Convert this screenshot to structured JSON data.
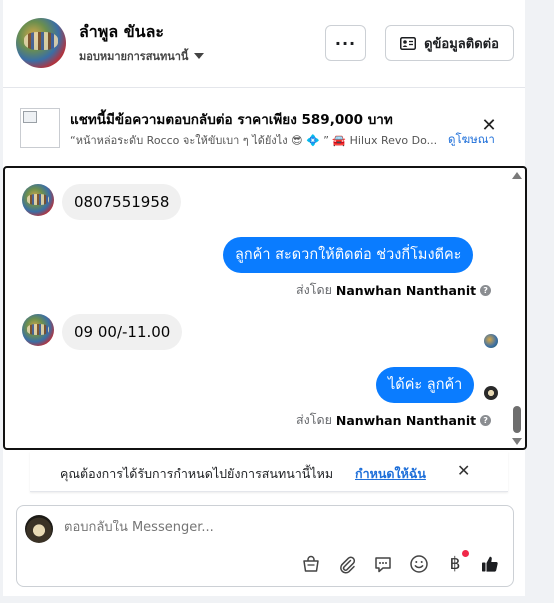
{
  "header": {
    "name": "ลำพูล ขันละ",
    "assign_label": "มอบหมายการสนทนานี้",
    "more_label": "···",
    "contact_label": "ดูข้อมูลติดต่อ"
  },
  "ad": {
    "title": "แชทนี้มีข้อความตอบกลับต่อ ราคาเพียง 589,000 บาท",
    "subtitle": "“หน้าหล่อระดับ Rocco จะให้ขับเบา ๆ ได้ยังไง 😎 💠 ” 🚘 Hilux Revo Do...",
    "link": "ดูโฆษณา",
    "close": "✕"
  },
  "messages": [
    {
      "direction": "in",
      "text": "0807551958"
    },
    {
      "direction": "out",
      "text": "ลูกค้า สะดวกให้ติดต่อ ช่วงกี่โมงดีคะ",
      "sent_prefix": "ส่งโดย",
      "sent_by": "Nanwhan Nanthanit"
    },
    {
      "direction": "in",
      "text": "09  00/-11.00"
    },
    {
      "direction": "out",
      "text": "ได้ค่ะ  ลูกค้า",
      "sent_prefix": "ส่งโดย",
      "sent_by": "Nanwhan Nanthanit"
    }
  ],
  "notice": {
    "text": "คุณต้องการได้รับการกำหนดไปยังการสนทนานี้ไหม",
    "link": "กำหนดให้ฉัน",
    "close": "✕"
  },
  "composer": {
    "placeholder": "ตอบกลับใน Messenger...",
    "baht_symbol": "฿"
  },
  "icons": {
    "toolbar": [
      "shopping-bag-icon",
      "paperclip-icon",
      "chat-bubble-icon",
      "smiley-icon",
      "baht-icon",
      "thumbs-up-icon"
    ]
  },
  "colors": {
    "accent": "#0a7cff",
    "link": "#1e6fd9",
    "incoming_bubble": "#f0f0f0",
    "notification_dot": "#f02849"
  }
}
